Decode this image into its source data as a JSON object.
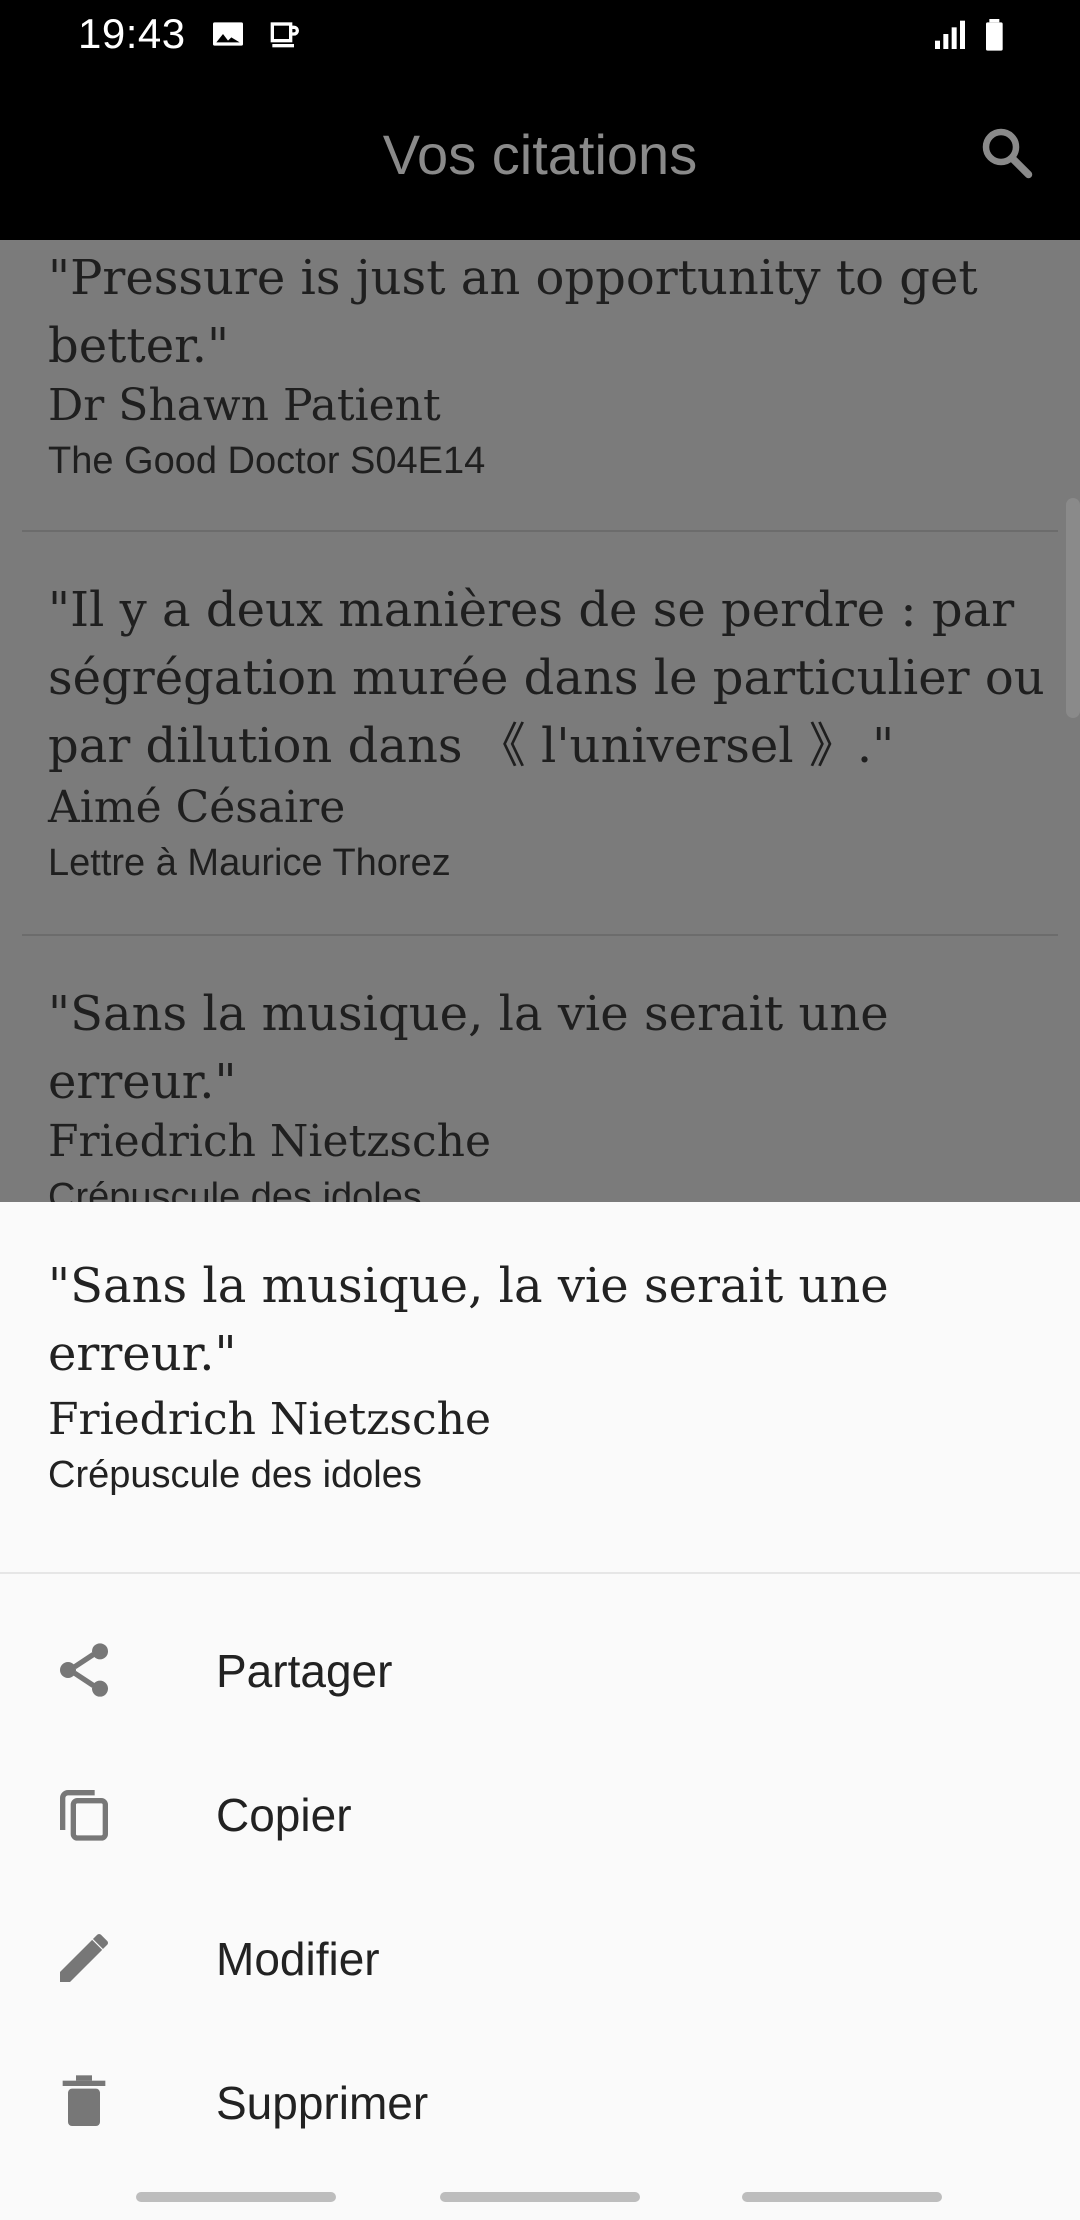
{
  "status": {
    "time": "19:43",
    "icons": [
      "image-icon",
      "coffee-icon",
      "signal-icon",
      "battery-icon"
    ]
  },
  "appbar": {
    "title": "Vos citations",
    "search_icon": "search-icon"
  },
  "list": {
    "items": [
      {
        "quote": "\"Pressure is just an opportunity to get better.\"",
        "author": "Dr Shawn Patient",
        "source": "The Good Doctor S04E14"
      },
      {
        "quote": "\"Il y a deux manières de se perdre : par ségrégation murée dans le particulier ou par dilution dans 《 l'universel 》.\"",
        "author": "Aimé Césaire",
        "source": "Lettre à Maurice Thorez"
      },
      {
        "quote": "\"Sans la musique, la vie serait une erreur.\"",
        "author": "Friedrich Nietzsche",
        "source": "Crépuscule des idoles"
      }
    ]
  },
  "sheet": {
    "quote": "\"Sans la musique, la vie serait une erreur.\"",
    "author": "Friedrich Nietzsche",
    "source": "Crépuscule des idoles",
    "actions": [
      {
        "label": "Partager",
        "icon": "share-icon"
      },
      {
        "label": "Copier",
        "icon": "copy-icon"
      },
      {
        "label": "Modifier",
        "icon": "edit-icon"
      },
      {
        "label": "Supprimer",
        "icon": "delete-icon"
      }
    ]
  },
  "colors": {
    "appbar_bg": "#000000",
    "scrim_list_bg": "#7b7b7b",
    "sheet_bg": "#fafafa",
    "text_dark": "#222222",
    "icon_gray": "#777777"
  }
}
